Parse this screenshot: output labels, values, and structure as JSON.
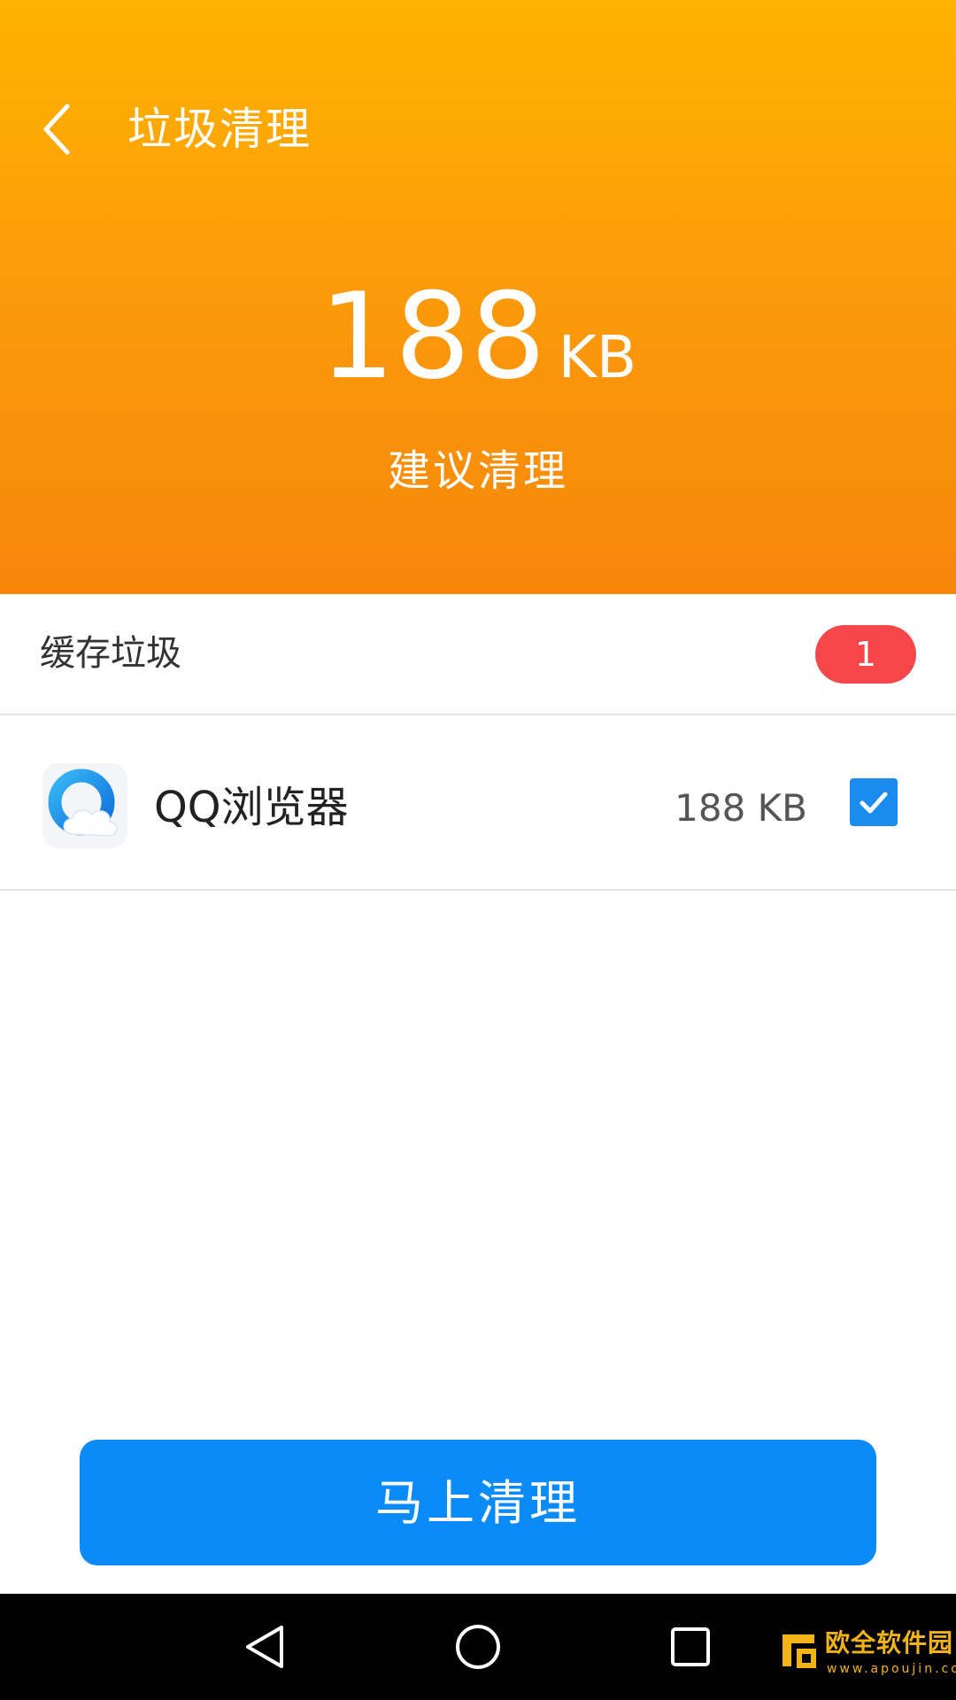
{
  "header": {
    "title": "垃圾清理",
    "junk_size_value": "188",
    "junk_size_unit": "KB",
    "suggestion": "建议清理",
    "gradient_top": "#FFB300",
    "gradient_bottom": "#F7860A"
  },
  "section": {
    "title": "缓存垃圾",
    "count": "1",
    "badge_color": "#F5474B"
  },
  "items": [
    {
      "app_name": "QQ浏览器",
      "size": "188 KB",
      "checked": true,
      "icon": "qq-browser-icon"
    }
  ],
  "action": {
    "label": "马上清理",
    "color": "#0A8BF9"
  },
  "nav": {
    "back_icon": "triangle-back-icon",
    "home_icon": "circle-home-icon",
    "recents_icon": "square-recents-icon"
  },
  "watermark": {
    "title": "欧全软件园",
    "url": "www.apoujin.com"
  }
}
